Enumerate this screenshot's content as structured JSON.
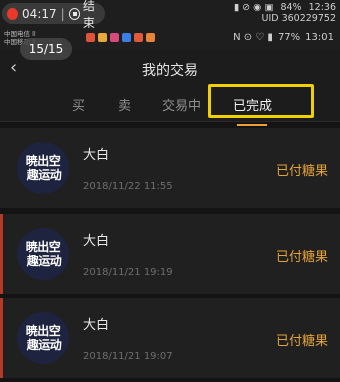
{
  "recorder": {
    "time": "04:17",
    "separator": "|",
    "stop_label": "结束"
  },
  "outer_status": {
    "icons": "▮ ⊘ ◉ ▣",
    "battery": "84%",
    "time": "12:36",
    "uid": "UID 360229752"
  },
  "inner_status": {
    "carrier_line1": "中国电信 ll",
    "carrier_line2": "中国移动 ll",
    "icons": "N ⊙ ♡ ▮",
    "battery": "77%",
    "time": "13:01"
  },
  "page_counter": "15/15",
  "nav": {
    "title": "我的交易",
    "back_icon": "chevron-left-icon"
  },
  "tabs": [
    {
      "label": "买",
      "active": false
    },
    {
      "label": "卖",
      "active": false
    },
    {
      "label": "交易中",
      "active": false
    },
    {
      "label": "已完成",
      "active": true
    }
  ],
  "avatar_text": {
    "line1": "暁出空",
    "line2": "趣运动"
  },
  "orders": [
    {
      "name": "大白",
      "date": "2018/11/22 11:55",
      "status": "已付糖果"
    },
    {
      "name": "大白",
      "date": "2018/11/21 19:19",
      "status": "已付糖果"
    },
    {
      "name": "大白",
      "date": "2018/11/21 19:07",
      "status": "已付糖果"
    }
  ],
  "colors": {
    "accent": "#e3a23a",
    "highlight": "#f0d000",
    "row_accent": "#b23a26"
  }
}
